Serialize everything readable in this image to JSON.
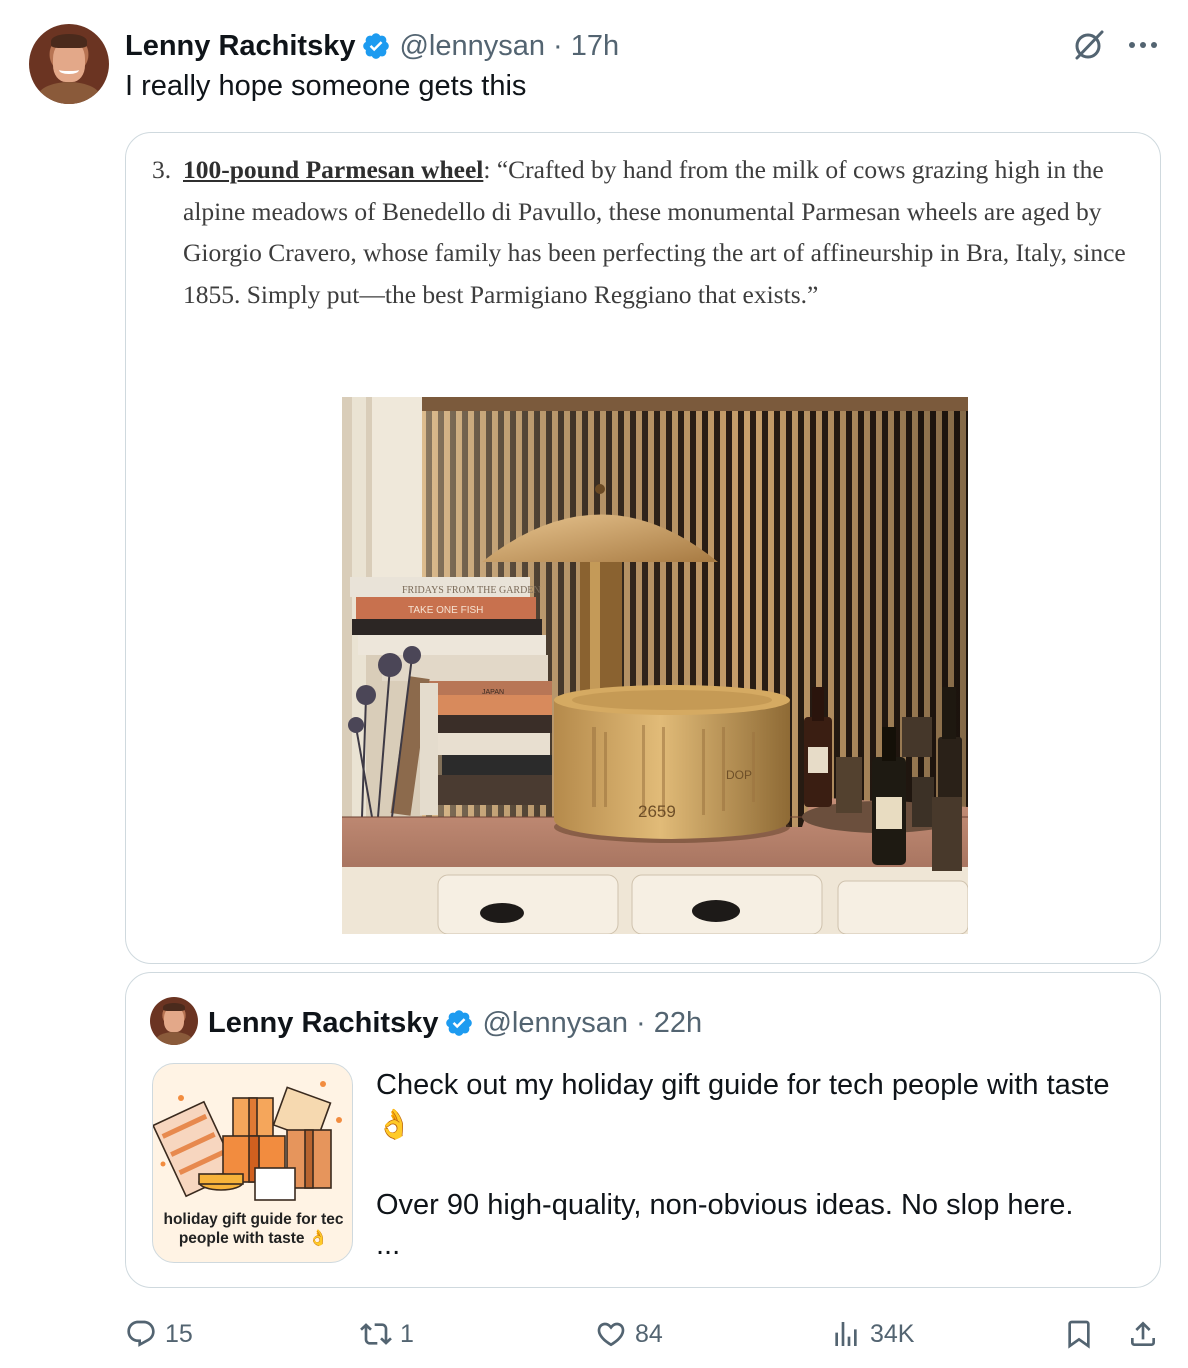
{
  "tweet": {
    "author": {
      "name": "Lenny Rachitsky",
      "handle": "@lennysan",
      "time": "17h"
    },
    "text": "I really hope someone gets this",
    "separator": "·",
    "menu_icons": [
      "grok-icon",
      "more-icon"
    ]
  },
  "excerpt": {
    "number": "3.",
    "link_text": "100-pound Parmesan wheel",
    "text": ": “Crafted by hand from the milk of cows grazing high in the alpine meadows of Benedello di Pavullo, these monumental Parmesan wheels are aged by Giorgio Cravero, whose family has been perfecting the art of affineurship in Bra, Italy, since 1855. Simply put—the best Parmigiano Reggiano that exists.”"
  },
  "photo": {
    "book_spines": [
      "FRIDAYS FROM THE GARDEN",
      "TAKE ONE FISH",
      "JAPAN"
    ],
    "cheese_marks": [
      "2659",
      "DOP"
    ]
  },
  "quoted": {
    "author": {
      "name": "Lenny Rachitsky",
      "handle": "@lennysan",
      "time": "22h"
    },
    "separator": "·",
    "thumb_caption": "holiday gift guide for tec\npeople with taste 👌",
    "line1": "Check out my holiday gift guide for tech people with taste 👌",
    "line2": "Over 90 high-quality, non-obvious ideas. No slop here.",
    "ellipsis": "..."
  },
  "actions": {
    "replies": "15",
    "reposts": "1",
    "likes": "84",
    "views": "34K"
  },
  "colors": {
    "verified": "#1d9bf0",
    "muted": "#536471",
    "border": "#cfd9de"
  }
}
